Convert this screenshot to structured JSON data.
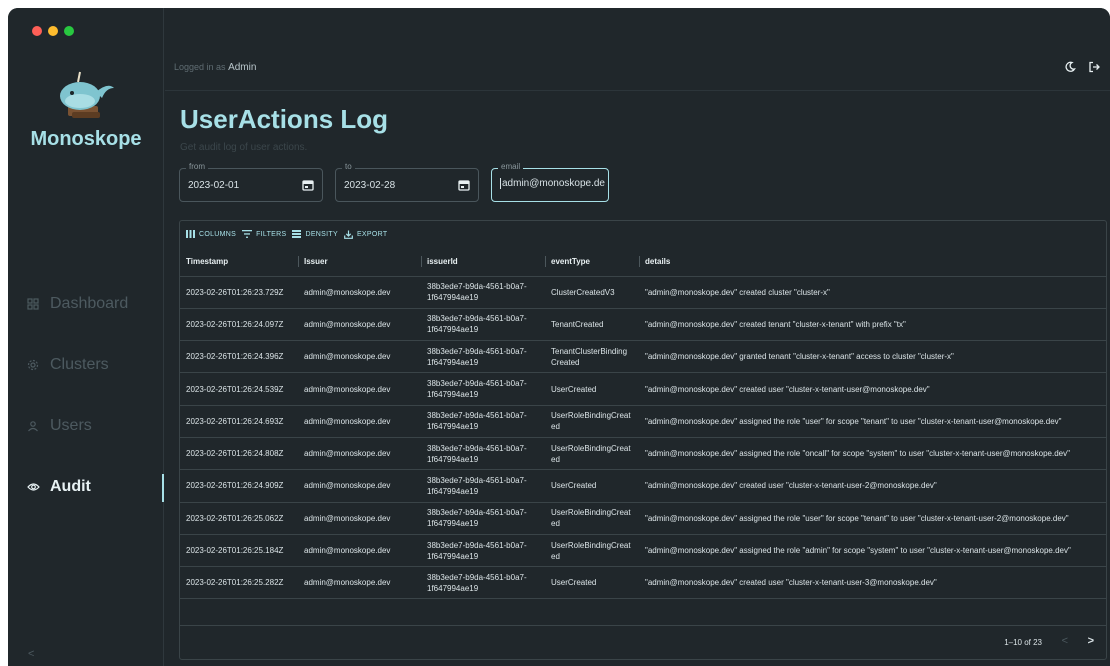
{
  "window": {
    "traffic_colors": [
      "#fe5f57",
      "#febc2e",
      "#28c840"
    ]
  },
  "sidebar": {
    "brand": "Monoskope",
    "items": [
      {
        "label": "Dashboard",
        "icon": "dashboard-icon",
        "active": false
      },
      {
        "label": "Clusters",
        "icon": "gear-icon",
        "active": false
      },
      {
        "label": "Users",
        "icon": "user-icon",
        "active": false
      },
      {
        "label": "Audit",
        "icon": "eye-icon",
        "active": true
      }
    ],
    "collapse_label": "<"
  },
  "header": {
    "logged_prefix": "Logged in as",
    "user": "Admin"
  },
  "page": {
    "title": "UserActions Log",
    "subtitle": "Get audit log of user actions."
  },
  "filters": {
    "from_label": "from",
    "from_value": "2023-02-01",
    "to_label": "to",
    "to_value": "2023-02-28",
    "email_label": "email",
    "email_value": "admin@monoskope.dev"
  },
  "toolbar": {
    "columns": "COLUMNS",
    "filters": "FILTERS",
    "density": "DENSITY",
    "export": "EXPORT"
  },
  "table": {
    "headers": [
      "Timestamp",
      "Issuer",
      "issuerId",
      "eventType",
      "details"
    ],
    "rows": [
      [
        "2023-02-26T01:26:23.729Z",
        "admin@monoskope.dev",
        "38b3ede7-b9da-4561-b0a7-1f647994ae19",
        "ClusterCreatedV3",
        "\"admin@monoskope.dev\" created cluster \"cluster-x\""
      ],
      [
        "2023-02-26T01:26:24.097Z",
        "admin@monoskope.dev",
        "38b3ede7-b9da-4561-b0a7-1f647994ae19",
        "TenantCreated",
        "\"admin@monoskope.dev\" created tenant \"cluster-x-tenant\" with prefix \"tx\""
      ],
      [
        "2023-02-26T01:26:24.396Z",
        "admin@monoskope.dev",
        "38b3ede7-b9da-4561-b0a7-1f647994ae19",
        "TenantClusterBinding Created",
        "\"admin@monoskope.dev\" granted tenant \"cluster-x-tenant\" access to cluster \"cluster-x\""
      ],
      [
        "2023-02-26T01:26:24.539Z",
        "admin@monoskope.dev",
        "38b3ede7-b9da-4561-b0a7-1f647994ae19",
        "UserCreated",
        "\"admin@monoskope.dev\" created user \"cluster-x-tenant-user@monoskope.dev\""
      ],
      [
        "2023-02-26T01:26:24.693Z",
        "admin@monoskope.dev",
        "38b3ede7-b9da-4561-b0a7-1f647994ae19",
        "UserRoleBindingCreat ed",
        "\"admin@monoskope.dev\" assigned the role \"user\" for scope \"tenant\" to user \"cluster-x-tenant-user@monoskope.dev\""
      ],
      [
        "2023-02-26T01:26:24.808Z",
        "admin@monoskope.dev",
        "38b3ede7-b9da-4561-b0a7-1f647994ae19",
        "UserRoleBindingCreat ed",
        "\"admin@monoskope.dev\" assigned the role \"oncall\" for scope \"system\" to user \"cluster-x-tenant-user@monoskope.dev\""
      ],
      [
        "2023-02-26T01:26:24.909Z",
        "admin@monoskope.dev",
        "38b3ede7-b9da-4561-b0a7-1f647994ae19",
        "UserCreated",
        "\"admin@monoskope.dev\" created user \"cluster-x-tenant-user-2@monoskope.dev\""
      ],
      [
        "2023-02-26T01:26:25.062Z",
        "admin@monoskope.dev",
        "38b3ede7-b9da-4561-b0a7-1f647994ae19",
        "UserRoleBindingCreat ed",
        "\"admin@monoskope.dev\" assigned the role \"user\" for scope \"tenant\" to user \"cluster-x-tenant-user-2@monoskope.dev\""
      ],
      [
        "2023-02-26T01:26:25.184Z",
        "admin@monoskope.dev",
        "38b3ede7-b9da-4561-b0a7-1f647994ae19",
        "UserRoleBindingCreat ed",
        "\"admin@monoskope.dev\" assigned the role \"admin\" for scope \"system\" to user \"cluster-x-tenant-user@monoskope.dev\""
      ],
      [
        "2023-02-26T01:26:25.282Z",
        "admin@monoskope.dev",
        "38b3ede7-b9da-4561-b0a7-1f647994ae19",
        "UserCreated",
        "\"admin@monoskope.dev\" created user \"cluster-x-tenant-user-3@monoskope.dev\""
      ]
    ]
  },
  "pagination": {
    "text": "1–10 of 23",
    "prev": "<",
    "next": ">"
  }
}
